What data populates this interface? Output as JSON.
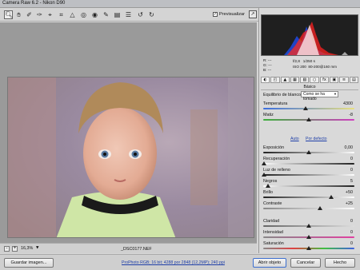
{
  "window": {
    "title": "Camera Raw 6.2 - Nikon D90"
  },
  "toolbar": {
    "tools": [
      "zoom-icon",
      "hand-icon",
      "white-balance-icon",
      "color-sampler-icon",
      "target-adjust-icon",
      "crop-icon",
      "straighten-icon",
      "spot-removal-icon",
      "red-eye-icon",
      "adjustment-brush-icon",
      "graduated-filter-icon",
      "preferences-icon",
      "rotate-left-icon",
      "rotate-right-icon"
    ],
    "preview_label": "Previsualizar",
    "preview_checked": true
  },
  "info": {
    "r_label": "R:",
    "g_label": "G:",
    "b_label": "B:",
    "r_value": "---",
    "g_value": "---",
    "b_value": "---",
    "aperture": "f/2,8",
    "shutter": "1/250 s",
    "iso": "ISO 200",
    "lens": "80-200@160 mm"
  },
  "panel": {
    "section_title": "Básico",
    "wb_label": "Equilibrio de blancos:",
    "wb_value": "Como se ha tomado",
    "auto_label": "Auto",
    "default_label": "Por defecto",
    "controls": [
      {
        "label": "Temperatura",
        "value": "4300"
      },
      {
        "label": "Matiz",
        "value": "-8"
      },
      {
        "label": "Exposición",
        "value": "0,00"
      },
      {
        "label": "Recuperación",
        "value": "0"
      },
      {
        "label": "Luz de relleno",
        "value": "0"
      },
      {
        "label": "Negros",
        "value": "5"
      },
      {
        "label": "Brillo",
        "value": "+50"
      },
      {
        "label": "Contraste",
        "value": "+25"
      },
      {
        "label": "Claridad",
        "value": "0"
      },
      {
        "label": "Intensidad",
        "value": "0"
      },
      {
        "label": "Saturación",
        "value": "0"
      }
    ]
  },
  "status": {
    "zoom": "16,3%",
    "filename": "_DSC0177.NEF"
  },
  "footer": {
    "save_label": "Guardar imagen...",
    "workflow": "ProPhoto RGB; 16 bit; 4288 por 2848 (12,2MP); 240 ppi",
    "open_label": "Abrir objeto",
    "cancel_label": "Cancelar",
    "done_label": "Hecho"
  },
  "colors": {
    "accent": "#1f3fa8",
    "histogram_bg": "#1f1f1f"
  }
}
